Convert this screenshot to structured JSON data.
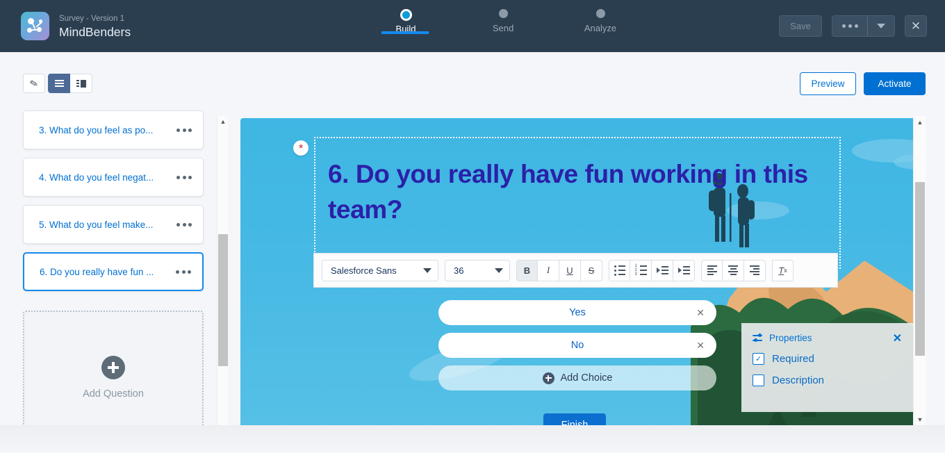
{
  "header": {
    "app_icon": "survey-network-icon",
    "subtitle": "Survey - Version 1",
    "title": "MindBenders",
    "steps": [
      {
        "label": "Build",
        "active": true
      },
      {
        "label": "Send",
        "active": false
      },
      {
        "label": "Analyze",
        "active": false
      }
    ],
    "save_label": "Save",
    "more_icon": "ellipsis-icon",
    "caret_icon": "chevron-down-icon",
    "close_icon": "close-icon"
  },
  "toolbar": {
    "brush_icon": "brush-icon",
    "list_view_icon": "list-view-icon",
    "panel_view_icon": "panel-view-icon",
    "preview_label": "Preview",
    "activate_label": "Activate",
    "accent_color": "#0070d2"
  },
  "sidebar": {
    "questions": [
      {
        "label": "3. What do you feel as po...",
        "selected": false
      },
      {
        "label": "4. What do you feel negat...",
        "selected": false
      },
      {
        "label": "5. What do you feel make...",
        "selected": false
      },
      {
        "label": "6. Do you really have fun ...",
        "selected": true
      }
    ],
    "menu_icon": "ellipsis-icon",
    "add_question_label": "Add Question",
    "add_icon": "plus-circle-icon",
    "scroll_up_icon": "chevron-up-icon",
    "scroll_down_icon": "chevron-down-icon"
  },
  "canvas": {
    "required_marker": "*",
    "question_title": "6. Do you really have fun working in this team?",
    "question_title_color": "#2b20a8",
    "background_color": "#46b9e4",
    "rte": {
      "font_family_value": "Salesforce Sans",
      "font_size_value": "36",
      "bold_label": "B",
      "italic_label": "I",
      "underline_label": "U",
      "strikethrough_label": "S",
      "bullet_list_icon": "bulleted-list-icon",
      "numbered_list_icon": "numbered-list-icon",
      "indent_icon": "indent-icon",
      "outdent_icon": "outdent-icon",
      "align_left_icon": "align-left-icon",
      "align_center_icon": "align-center-icon",
      "align_right_icon": "align-right-icon",
      "clear_format_label": "T",
      "clear_format_sub": "x",
      "bold_active": true
    },
    "choices": [
      {
        "label": "Yes",
        "remove_icon": "close-icon"
      },
      {
        "label": "No",
        "remove_icon": "close-icon"
      }
    ],
    "add_choice_label": "Add Choice",
    "add_choice_icon": "plus-circle-icon",
    "finish_label": "Finish",
    "illustration": "hikers-on-mountain-peak"
  },
  "properties": {
    "icon": "settings-sliders-icon",
    "title": "Properties",
    "close_icon": "close-icon",
    "options": [
      {
        "label": "Required",
        "checked": true,
        "check_mark": "✓"
      },
      {
        "label": "Description",
        "checked": false,
        "check_mark": ""
      }
    ]
  }
}
